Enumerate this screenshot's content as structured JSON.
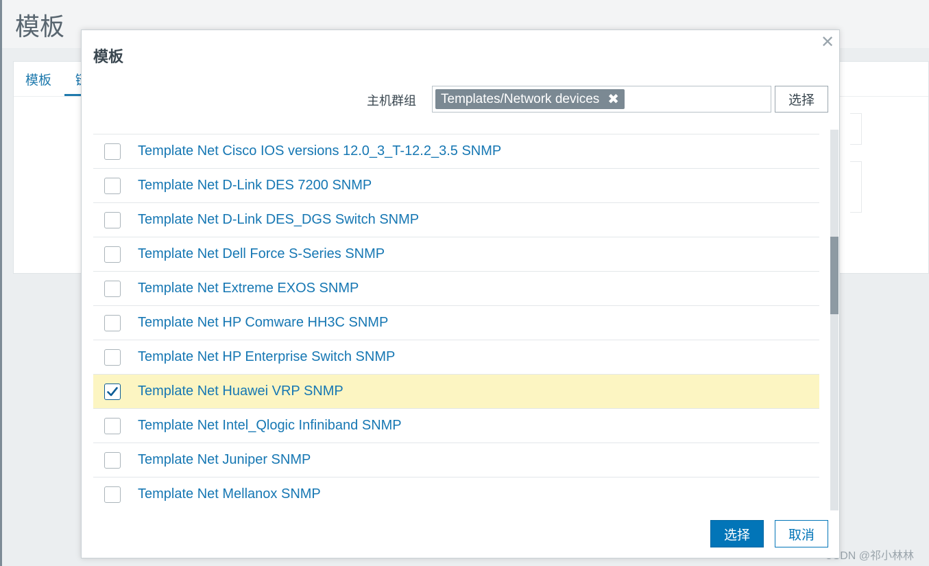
{
  "background": {
    "page_title": "模板",
    "tabs": [
      "模板",
      "链"
    ],
    "watermark": "CSDN @祁小林林"
  },
  "modal": {
    "title": "模板",
    "close_icon": "close-icon",
    "filter": {
      "label": "主机群组",
      "chip_label": "Templates/Network devices",
      "select_button": "选择"
    },
    "rows": [
      {
        "label": "Template Net Cisco IOS versions 12.0_3_T-12.2_3.5 SNMP",
        "checked": false
      },
      {
        "label": "Template Net D-Link DES 7200 SNMP",
        "checked": false
      },
      {
        "label": "Template Net D-Link DES_DGS Switch SNMP",
        "checked": false
      },
      {
        "label": "Template Net Dell Force S-Series SNMP",
        "checked": false
      },
      {
        "label": "Template Net Extreme EXOS SNMP",
        "checked": false
      },
      {
        "label": "Template Net HP Comware HH3C SNMP",
        "checked": false
      },
      {
        "label": "Template Net HP Enterprise Switch SNMP",
        "checked": false
      },
      {
        "label": "Template Net Huawei VRP SNMP",
        "checked": true
      },
      {
        "label": "Template Net Intel_Qlogic Infiniband SNMP",
        "checked": false
      },
      {
        "label": "Template Net Juniper SNMP",
        "checked": false
      },
      {
        "label": "Template Net Mellanox SNMP",
        "checked": false
      }
    ],
    "footer": {
      "select_label": "选择",
      "cancel_label": "取消"
    }
  },
  "colors": {
    "accent": "#0275b8",
    "link": "#1677b3",
    "selected_row": "#fcf5c2"
  }
}
